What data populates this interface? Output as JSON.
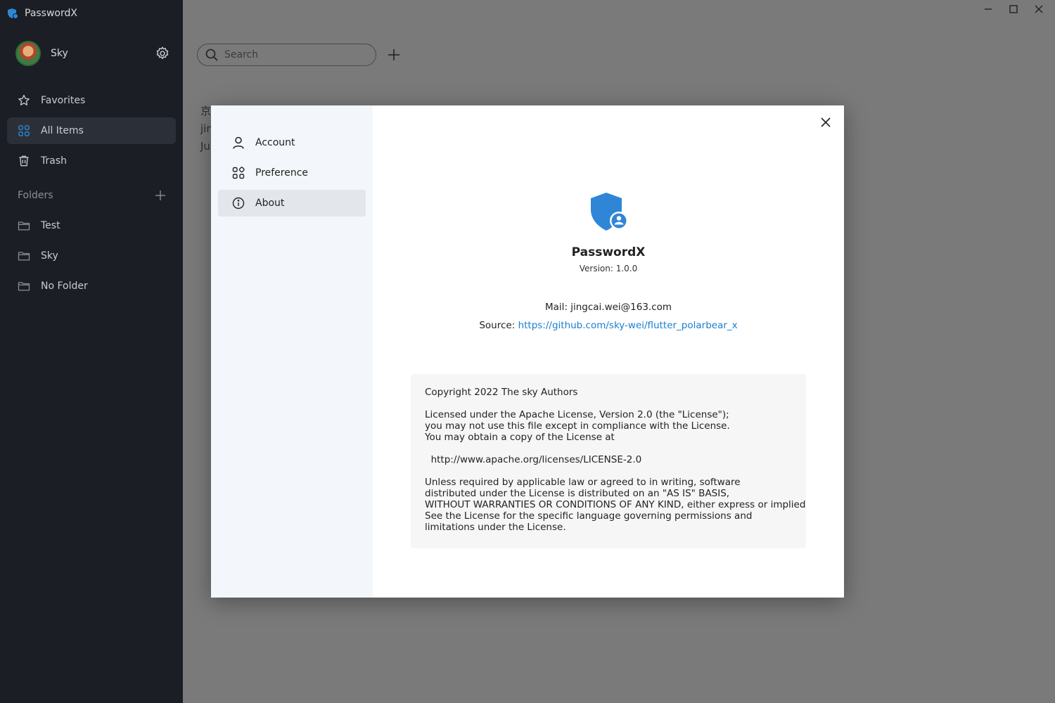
{
  "app": {
    "title": "PasswordX"
  },
  "user": {
    "name": "Sky"
  },
  "nav": [
    {
      "label": "Favorites",
      "icon": "star-icon"
    },
    {
      "label": "All Items",
      "icon": "grid-icon",
      "active": true
    },
    {
      "label": "Trash",
      "icon": "trash-icon"
    }
  ],
  "folders": {
    "heading": "Folders",
    "items": [
      "Test",
      "Sky",
      "No Folder"
    ]
  },
  "search": {
    "placeholder": "Search"
  },
  "background_item": {
    "title": "京",
    "line2": "jin",
    "line3": "Ju"
  },
  "dialog": {
    "nav": [
      {
        "label": "Account",
        "icon": "user-icon"
      },
      {
        "label": "Preference",
        "icon": "preference-icon"
      },
      {
        "label": "About",
        "icon": "info-icon",
        "active": true
      }
    ],
    "about": {
      "name": "PasswordX",
      "version": "Version: 1.0.0",
      "mail": "Mail: jingcai.wei@163.com",
      "source_prefix": "Source: ",
      "source_url": "https://github.com/sky-wei/flutter_polarbear_x",
      "license": "Copyright 2022 The sky Authors\n\nLicensed under the Apache License, Version 2.0 (the \"License\");\nyou may not use this file except in compliance with the License.\nYou may obtain a copy of the License at\n\n  http://www.apache.org/licenses/LICENSE-2.0\n\nUnless required by applicable law or agreed to in writing, software\ndistributed under the License is distributed on an \"AS IS\" BASIS,\nWITHOUT WARRANTIES OR CONDITIONS OF ANY KIND, either express or implied.\nSee the License for the specific language governing permissions and\nlimitations under the License."
    }
  },
  "colors": {
    "sidebar_bg": "#1b1e24",
    "accent": "#2f86d6",
    "link": "#1a7fd0",
    "overlay": "#7a7a7a"
  }
}
